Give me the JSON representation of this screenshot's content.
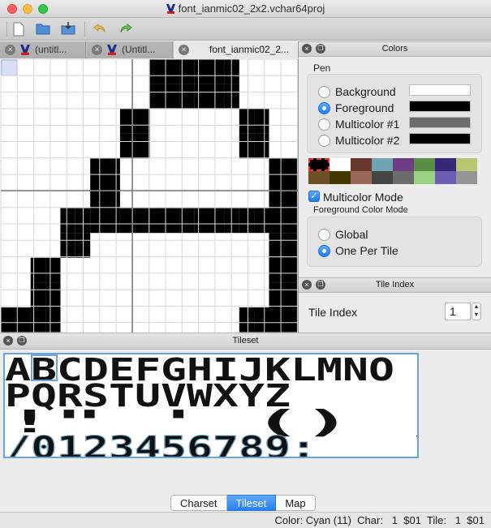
{
  "window": {
    "title": "font_ianmic02_2x2.vchar64proj"
  },
  "toolbar": {
    "buttons": [
      "new-file",
      "open-folder",
      "save",
      "undo",
      "redo"
    ]
  },
  "doc_tabs": [
    {
      "label": "(untitl...",
      "active": false
    },
    {
      "label": "(Untitl...",
      "active": false
    },
    {
      "label": "font_ianmic02_2...",
      "active": true
    }
  ],
  "colors_panel": {
    "title": "Colors",
    "pen_group_title": "Pen",
    "pens": [
      {
        "label": "Background",
        "color": "#ffffff",
        "selected": false
      },
      {
        "label": "Foreground",
        "color": "#000000",
        "selected": true
      },
      {
        "label": "Multicolor #1",
        "color": "#6c6c6c",
        "selected": false
      },
      {
        "label": "Multicolor #2",
        "color": "#000000",
        "selected": false
      }
    ],
    "palette": [
      "#000000",
      "#ffffff",
      "#68372b",
      "#70a4b2",
      "#6f3d86",
      "#588d43",
      "#352879",
      "#b8c76f",
      "#6f4f25",
      "#433900",
      "#9a6759",
      "#444444",
      "#6c6c6c",
      "#9ad284",
      "#6c5eb5",
      "#959595"
    ],
    "palette_selected": 0,
    "multicolor_mode": {
      "label": "Multicolor Mode",
      "checked": true
    },
    "fg_mode_group_title": "Foreground Color Mode",
    "fg_modes": [
      {
        "label": "Global",
        "selected": false
      },
      {
        "label": "One Per Tile",
        "selected": true
      }
    ]
  },
  "tile_index_panel": {
    "title": "Tile Index",
    "label": "Tile Index",
    "value": "1"
  },
  "tileset_panel": {
    "title": "Tileset",
    "rows": [
      "ABCDEFGHIJKLMNO",
      "PQRSTUVWXYZ",
      " !\"       ' ()    ,-.",
      "/0123456789:"
    ],
    "selected_tile": 1
  },
  "bottom_tabs": [
    {
      "label": "Charset",
      "active": false
    },
    {
      "label": "Tileset",
      "active": true
    },
    {
      "label": "Map",
      "active": false
    }
  ],
  "status": {
    "text": "Color: Cyan (11)  Char:   1  $01  Tile:   1  $01"
  },
  "editor": {
    "pixel_rows": [
      "..........XXXXXX......",
      "..........XXXXXX......",
      "........XX......XX....",
      "........XX......XX....",
      "......XX..........XX..",
      "......XX..........XX..",
      "....XXXXXXXXXXXXXXXX..",
      "....XX............XX..",
      "..XX..............XX..",
      "..XX..............XX..",
      "XXXX............XXXXXX",
      "......................"
    ]
  }
}
